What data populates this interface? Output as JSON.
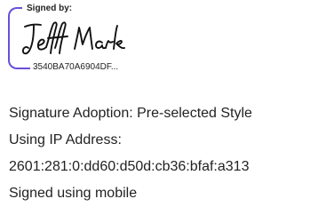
{
  "signature": {
    "signed_by_label": "Signed by:",
    "handwritten_name": "Jeff Mark",
    "envelope_id": "3540BA70A6904DF...",
    "accent_color": "#6a4fd9"
  },
  "details": {
    "adoption": "Signature Adoption: Pre-selected Style",
    "ip_label": "Using IP Address:",
    "ip_address": "2601:281:0:dd60:d50d:cb36:bfaf:a313",
    "signed_using": "Signed using mobile"
  }
}
